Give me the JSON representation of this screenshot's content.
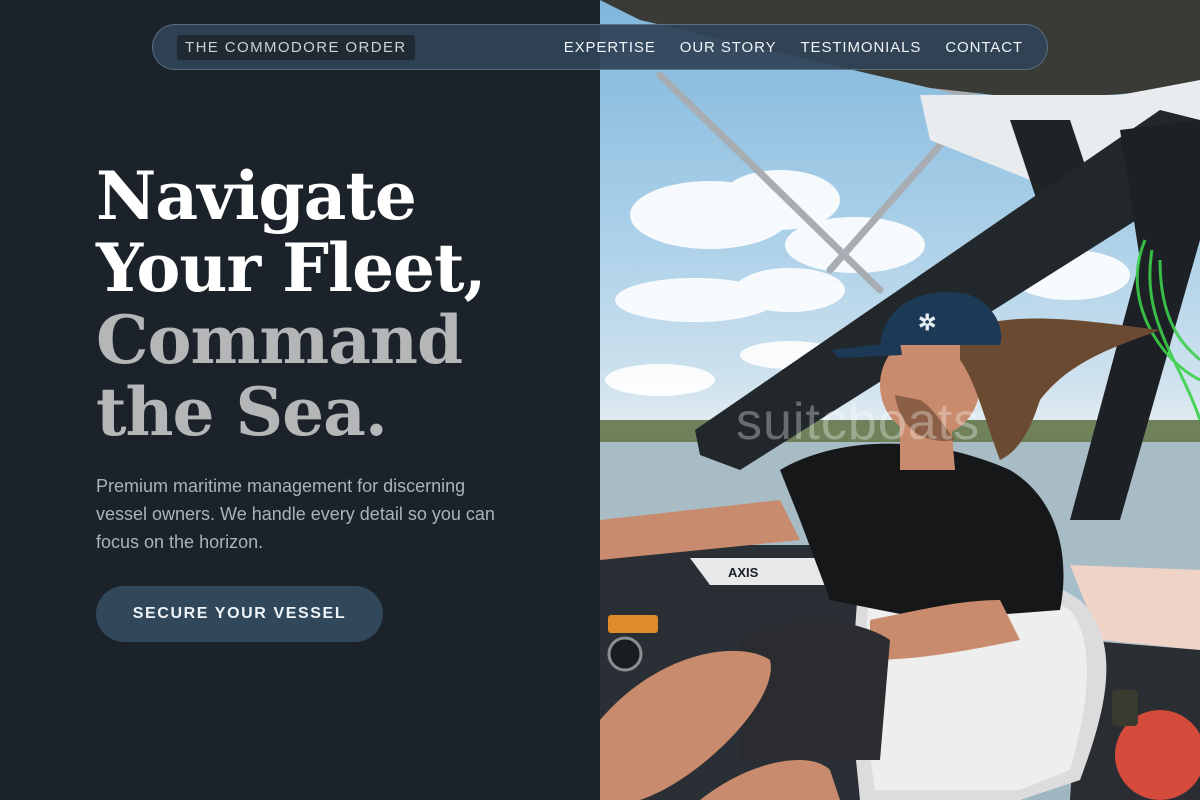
{
  "nav": {
    "brand": "THE COMMODORE ORDER",
    "links": [
      "EXPERTISE",
      "OUR STORY",
      "TESTIMONIALS",
      "CONTACT"
    ]
  },
  "hero": {
    "headline": {
      "line1": "Navigate",
      "line2": "Your Fleet,",
      "line3": "Command",
      "line4": "the Sea."
    },
    "subtext": "Premium maritime management for discerning vessel owners. We handle every detail so you can focus on the horizon.",
    "cta_label": "SECURE YOUR VESSEL",
    "image": {
      "subject": "man with long hair driving a wakeboat on a lake",
      "watermark": "suitcboats"
    }
  },
  "colors": {
    "background": "#1b222a",
    "nav_bg": "#2f4356",
    "headline_primary": "#ffffff",
    "headline_secondary": "#b4b6b8",
    "subtext": "#a9b3bc",
    "cta_bg": "#31475a"
  }
}
